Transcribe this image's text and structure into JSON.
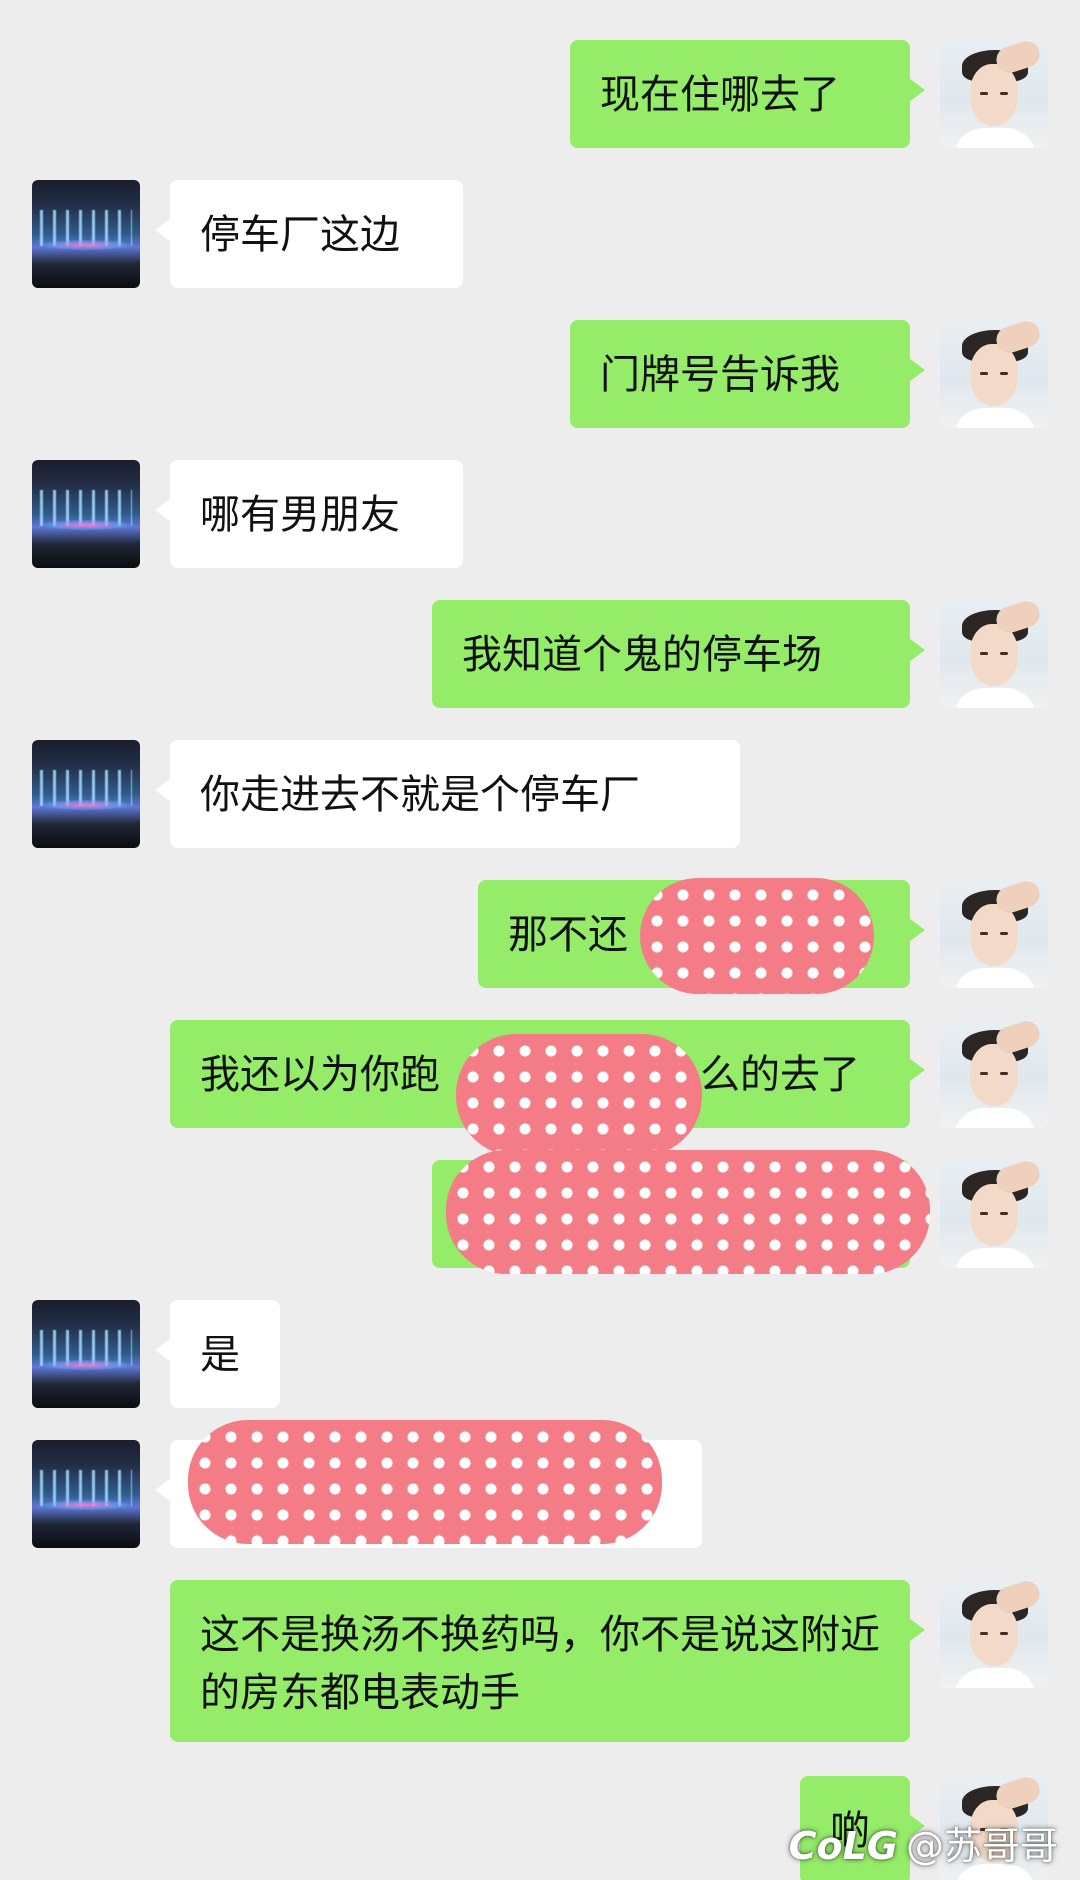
{
  "messages": [
    {
      "side": "out",
      "text": "现在住哪去了"
    },
    {
      "side": "in",
      "text": "停车厂这边"
    },
    {
      "side": "out",
      "text": "门牌号告诉我"
    },
    {
      "side": "in",
      "text": "哪有男朋友"
    },
    {
      "side": "out",
      "text": "我知道个鬼的停车场"
    },
    {
      "side": "in",
      "text": "你走进去不就是个停车厂"
    },
    {
      "side": "out",
      "text": "那不还"
    },
    {
      "side": "out",
      "text_start": "我还以为你跑",
      "text_end": "么的去了"
    },
    {
      "side": "in",
      "text": "是"
    },
    {
      "side": "out",
      "text": "这不是换汤不换药吗，你不是说这附近的房东都电表动手"
    },
    {
      "side": "out",
      "text": "啲"
    }
  ],
  "watermark": {
    "logo": "CoLG",
    "handle": "@苏哥哥"
  }
}
